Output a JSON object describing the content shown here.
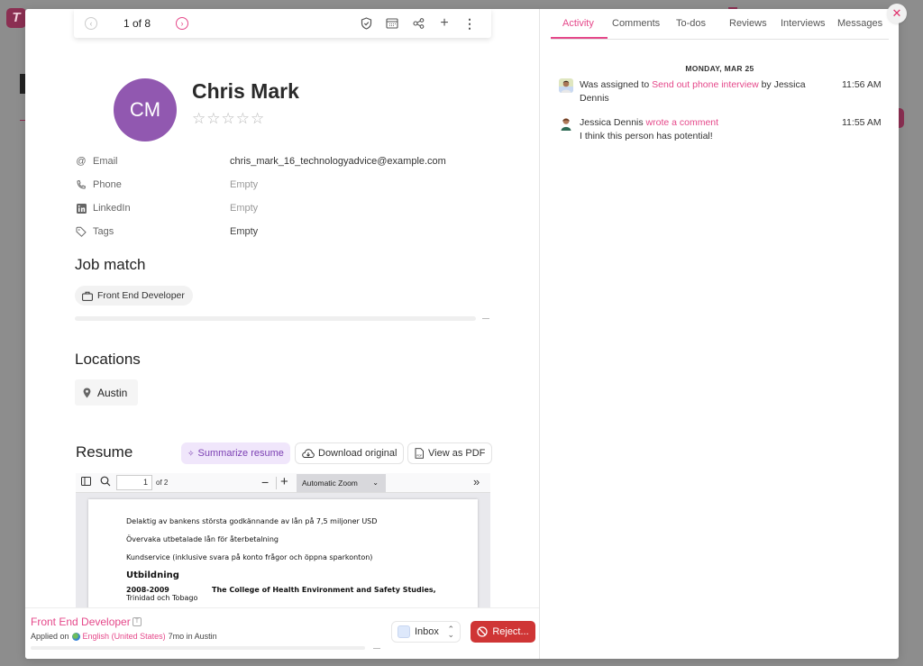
{
  "background": {
    "logo_letter": "T"
  },
  "navigation": {
    "counter": "1 of 8",
    "icons": [
      "shield-check-icon",
      "calendar-icon",
      "share-icon",
      "plus-icon",
      "more-vertical-icon"
    ]
  },
  "candidate": {
    "initials": "CM",
    "name": "Chris Mark",
    "rating": 0,
    "rating_max": 5,
    "avatar_color": "#9158b0"
  },
  "details": [
    {
      "icon": "at-icon",
      "label": "Email",
      "value": "chris_mark_16_technologyadvice@example.com"
    },
    {
      "icon": "phone-icon",
      "label": "Phone",
      "value": "Empty"
    },
    {
      "icon": "linkedin-icon",
      "label": "LinkedIn",
      "value": "Empty"
    },
    {
      "icon": "tag-icon",
      "label": "Tags",
      "value": "Empty"
    }
  ],
  "job_match": {
    "title": "Job match",
    "job": "Front End Developer"
  },
  "locations": {
    "title": "Locations",
    "items": [
      "Austin"
    ]
  },
  "resume": {
    "title": "Resume",
    "summarize_label": "Summarize resume",
    "download_label": "Download original",
    "pdf_label": "View as PDF",
    "viewer": {
      "page": "1",
      "page_total": "of 2",
      "zoom": "Automatic Zoom"
    },
    "content": {
      "lines": [
        "Delaktig av bankens största godkännande av lån på 7,5 miljoner USD",
        "Övervaka utbetalade lån för återbetalning",
        "Kundservice (inklusive svara på konto frågor och öppna sparkonton)"
      ],
      "heading": "Utbildning",
      "edu_years": "2008-2009",
      "edu_school": "The College of Health Environment and Safety Studies,",
      "edu_location": "Trinidad och Tobago"
    }
  },
  "footer": {
    "job_title": "Front End Developer",
    "applied_prefix": "Applied on",
    "language": "English (United States)",
    "applied_suffix": "7mo in Austin",
    "stage": "Inbox",
    "reject_label": "Reject..."
  },
  "tabs": [
    {
      "label": "Activity",
      "active": true
    },
    {
      "label": "Comments",
      "active": false
    },
    {
      "label": "To-dos",
      "active": false
    },
    {
      "label": "Reviews",
      "active": false
    },
    {
      "label": "Interviews",
      "active": false
    },
    {
      "label": "Messages",
      "active": false
    }
  ],
  "activity": {
    "date": "MONDAY, MAR 25",
    "items": [
      {
        "pre": "Was assigned to ",
        "link": "Send out phone interview",
        "post": " by Jessica Dennis",
        "time": "11:56 AM"
      },
      {
        "pre": "Jessica Dennis ",
        "link": "wrote a comment",
        "post": "",
        "body": "I think this person has potential!",
        "time": "11:55 AM"
      }
    ]
  },
  "colors": {
    "accent": "#e5488a",
    "reject": "#cf3535",
    "summarize_bg": "#f0e6fb"
  }
}
